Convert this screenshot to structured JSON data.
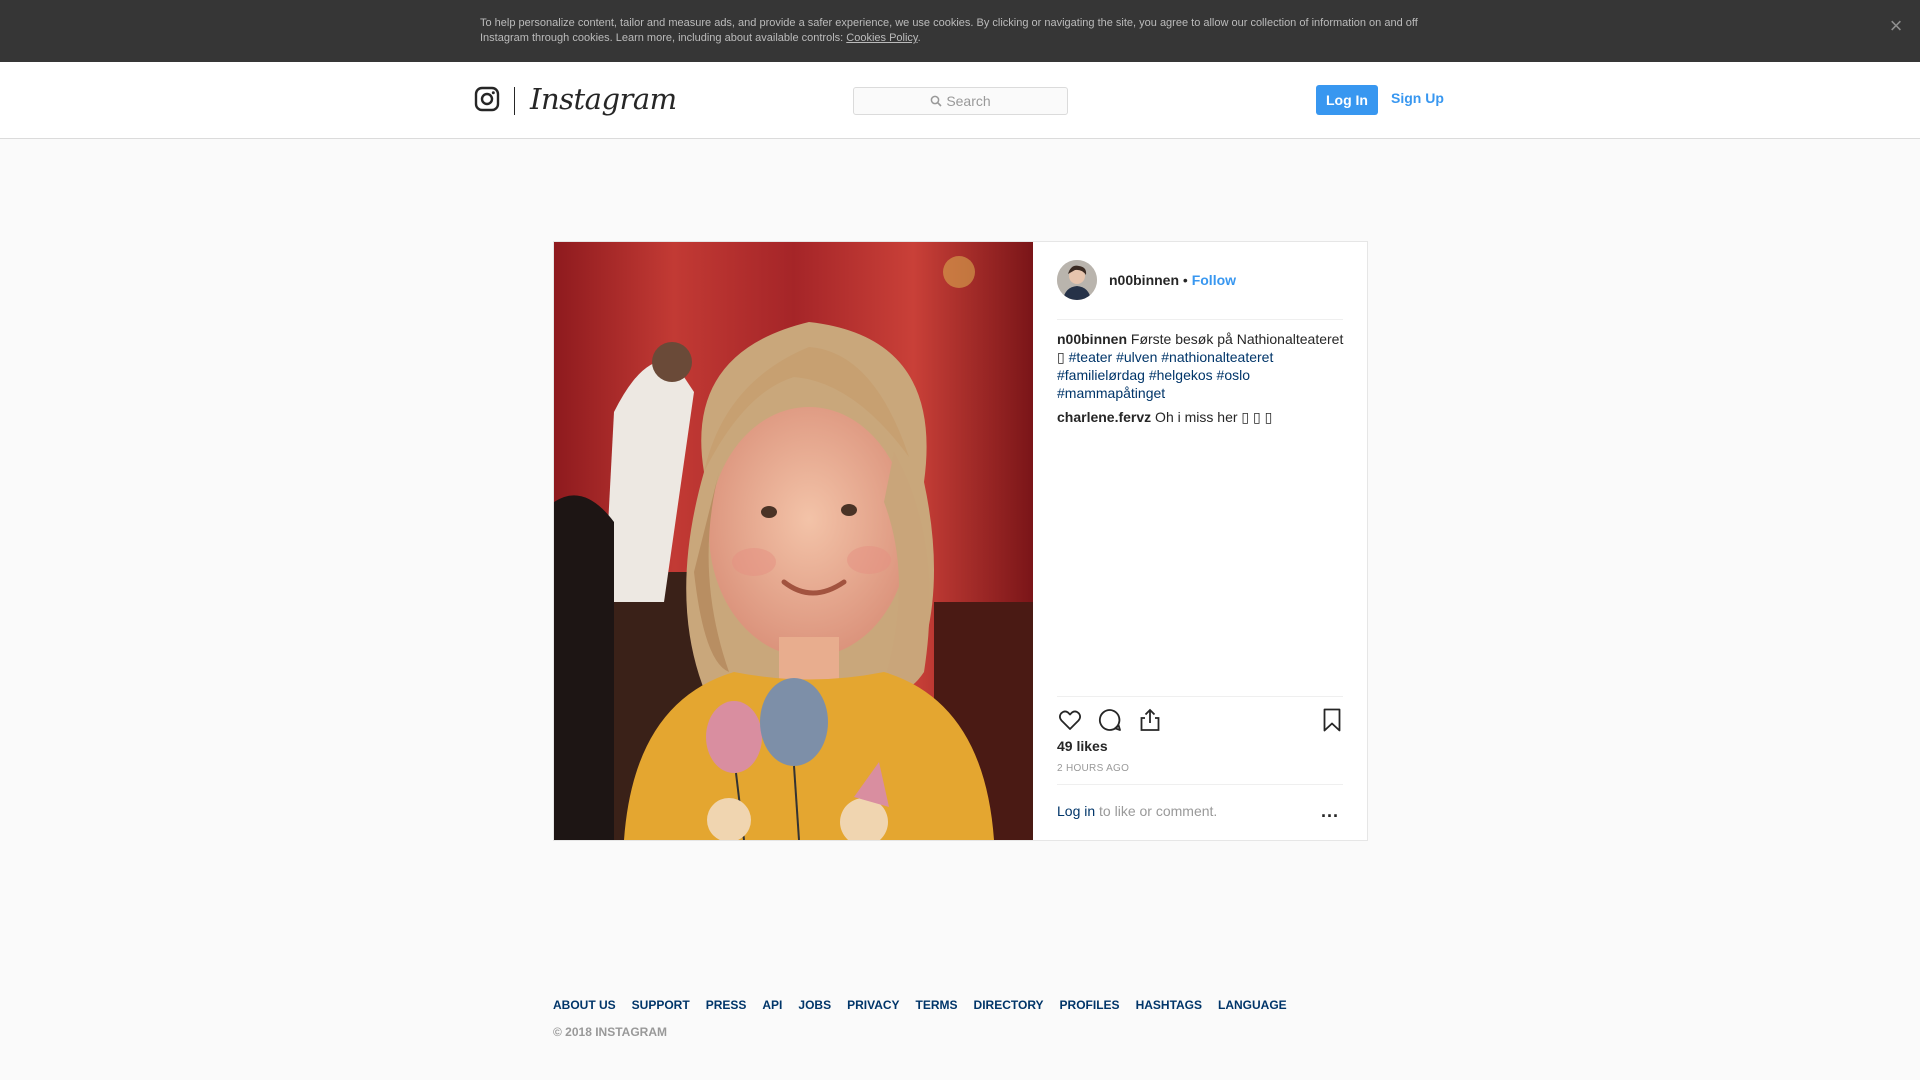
{
  "cookie_banner": {
    "text": "To help personalize content, tailor and measure ads, and provide a safer experience, we use cookies. By clicking or navigating the site, you agree to allow our collection of information on and off Instagram through cookies. Learn more, including about available controls: ",
    "policy_link": "Cookies Policy",
    "period": ".",
    "close_glyph": "×"
  },
  "header": {
    "logo_text": "Instagram",
    "search_placeholder": "Search",
    "login_label": "Log In",
    "signup_label": "Sign Up"
  },
  "post": {
    "username": "n00binnen",
    "separator": "•",
    "follow_label": "Follow",
    "caption": {
      "username": "n00binnen",
      "text": "Første besøk på Nathionalteateret",
      "emoji_glyph": "▯",
      "hashtags": [
        "#teater",
        "#ulven",
        "#nathionalteateret",
        "#familielørdag",
        "#helgekos",
        "#oslo",
        "#mammapåtinget"
      ]
    },
    "comments": [
      {
        "username": "charlene.fervz",
        "text": "Oh i miss her ▯ ▯ ▯"
      }
    ],
    "likes": "49 likes",
    "time_ago": "2 HOURS AGO",
    "login_link": "Log in",
    "login_suffix": " to like or comment.",
    "more_glyph": "..."
  },
  "footer": {
    "links": [
      "ABOUT US",
      "SUPPORT",
      "PRESS",
      "API",
      "JOBS",
      "PRIVACY",
      "TERMS",
      "DIRECTORY",
      "PROFILES",
      "HASHTAGS",
      "LANGUAGE"
    ],
    "copyright": "© 2018 INSTAGRAM"
  },
  "colors": {
    "accent": "#3897f0",
    "link_dark": "#003569",
    "banner_bg": "#363636"
  },
  "icons": {
    "logo": "instagram-camera-icon",
    "search": "search-icon",
    "like": "heart-icon",
    "comment": "comment-bubble-icon",
    "share": "share-icon",
    "save": "bookmark-icon",
    "close": "close-icon"
  }
}
